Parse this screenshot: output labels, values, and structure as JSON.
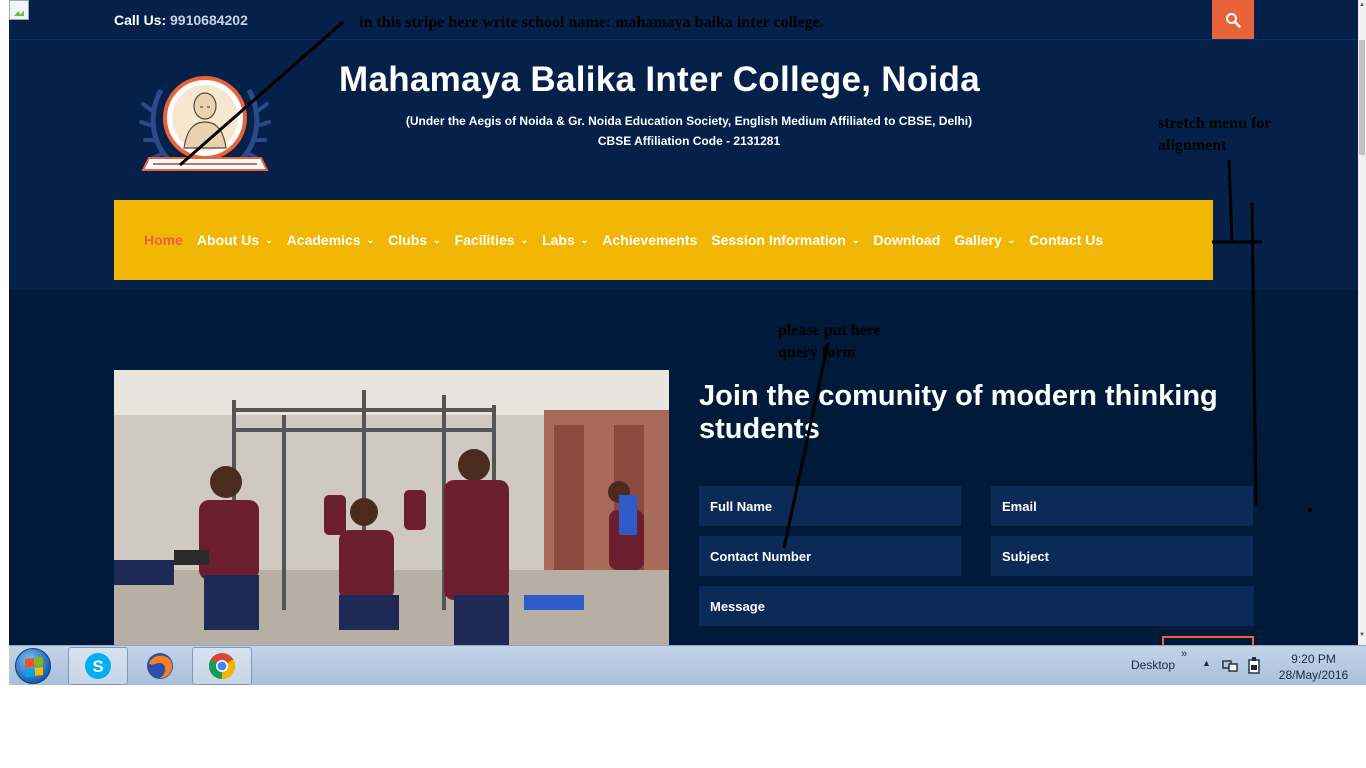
{
  "topbar": {
    "call_label": "Call Us:",
    "phone": "9910684202"
  },
  "header": {
    "school_name": "Mahamaya Balika Inter College, Noida",
    "subtitle_line1": "(Under the Aegis of Noida & Gr. Noida Education Society, English Medium Affiliated to CBSE, Delhi)",
    "subtitle_line2": "CBSE Affiliation Code - 2131281"
  },
  "nav": {
    "items": [
      {
        "label": "Home",
        "active": true,
        "dropdown": false
      },
      {
        "label": "About Us",
        "active": false,
        "dropdown": true
      },
      {
        "label": "Academics",
        "active": false,
        "dropdown": true
      },
      {
        "label": "Clubs",
        "active": false,
        "dropdown": true
      },
      {
        "label": "Facilities",
        "active": false,
        "dropdown": true
      },
      {
        "label": "Labs",
        "active": false,
        "dropdown": true
      },
      {
        "label": "Achievements",
        "active": false,
        "dropdown": false
      },
      {
        "label": "Session Information",
        "active": false,
        "dropdown": true
      },
      {
        "label": "Download",
        "active": false,
        "dropdown": false
      },
      {
        "label": "Gallery",
        "active": false,
        "dropdown": true
      },
      {
        "label": "Contact Us",
        "active": false,
        "dropdown": false
      }
    ],
    "caret": "⌄"
  },
  "form": {
    "heading": "Join the comunity of modern thinking students",
    "full_name": "Full Name",
    "email": "Email",
    "contact_number": "Contact Number",
    "subject": "Subject",
    "message": "Message"
  },
  "annotations": {
    "stripe_note": "in this stripe here write school name: mahamaya baika inter college.",
    "menu_note_1": "stretch menu for",
    "menu_note_2": "alignment",
    "form_note_1": "please put here",
    "form_note_2": "query form"
  },
  "taskbar": {
    "desktop_label": "Desktop",
    "time": "9:20 PM",
    "date": "28/May/2016"
  },
  "colors": {
    "navy": "#062149",
    "dark": "#001a3a",
    "accent": "#e8623a",
    "menu": "#f2b705"
  }
}
